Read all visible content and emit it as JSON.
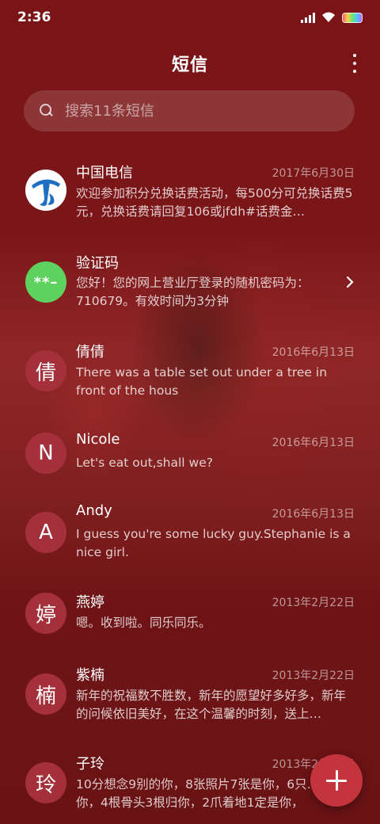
{
  "status_bar": {
    "time": "2:36"
  },
  "header": {
    "title": "短信"
  },
  "search": {
    "placeholder": "搜索11条短信"
  },
  "conversations": [
    {
      "name": "中国电信",
      "date": "2017年6月30日",
      "preview": "欢迎参加积分兑换话费活动，每500分可兑换话费5元，兑换话费请回复106或jfdh#话费金…",
      "avatar_icon": "china-telecom-logo",
      "avatar_color": "#1e6fc4"
    },
    {
      "name": "验证码",
      "date": "",
      "preview": "您好！您的网上营业厅登录的随机密码为：710679。有效时间为3分钟",
      "avatar_text": "**–",
      "avatar_color": "#5ed25e"
    },
    {
      "name": "倩倩",
      "date": "2016年6月13日",
      "preview": "There was a table set out under a tree in front of the hous",
      "avatar_text": "倩"
    },
    {
      "name": "Nicole",
      "date": "2016年6月13日",
      "preview": "Let's eat out,shall we?",
      "avatar_text": "N"
    },
    {
      "name": "Andy",
      "date": "2016年6月13日",
      "preview": "I guess you're some lucky guy.Stephanie is a nice girl.",
      "avatar_text": "A"
    },
    {
      "name": "燕婷",
      "date": "2013年2月22日",
      "preview": "嗯。收到啦。同乐同乐。",
      "avatar_text": "婷"
    },
    {
      "name": "紫楠",
      "date": "2013年2月22日",
      "preview": "新年的祝福数不胜数，新年的愿望好多好多，新年的问候依旧美好，在这个温馨的时刻，送上…",
      "avatar_text": "楠"
    },
    {
      "name": "子玲",
      "date": "2013年2月22日",
      "preview": "10分想念9别的你，8张照片7张是你，6只…只像你，4根骨头3根归你，2爪着地1定是你，",
      "avatar_text": "玲"
    }
  ],
  "colors": {
    "background": "#7a1417",
    "avatar": "#a3303a",
    "fab": "#c4343c"
  }
}
